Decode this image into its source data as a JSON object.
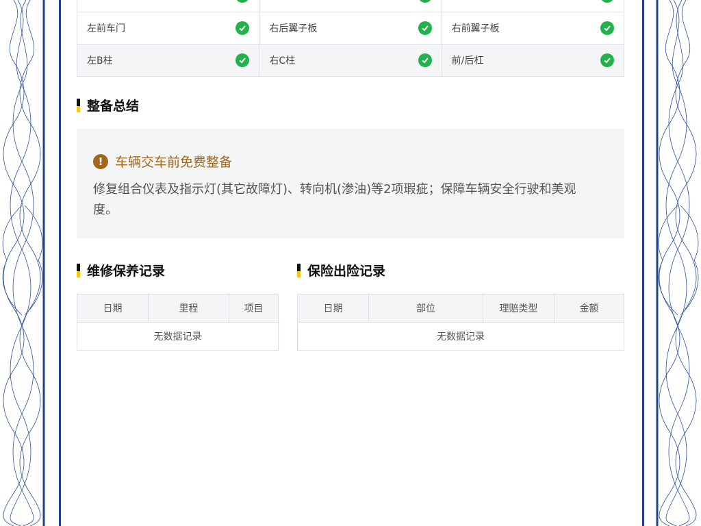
{
  "inspection_grid": {
    "rows": [
      {
        "cells": [
          {
            "label": "",
            "status_icon": "check-circle-icon"
          },
          {
            "label": "",
            "status_icon": "check-circle-icon"
          },
          {
            "label": "",
            "status_icon": "check-circle-icon"
          }
        ]
      },
      {
        "cells": [
          {
            "label": "左前车门",
            "status_icon": "check-circle-icon"
          },
          {
            "label": "右后翼子板",
            "status_icon": "check-circle-icon"
          },
          {
            "label": "右前翼子板",
            "status_icon": "check-circle-icon"
          }
        ]
      },
      {
        "cells": [
          {
            "label": "左B柱",
            "status_icon": "check-circle-icon"
          },
          {
            "label": "右C柱",
            "status_icon": "check-circle-icon"
          },
          {
            "label": "前/后杠",
            "status_icon": "check-circle-icon"
          }
        ]
      }
    ],
    "ok_color": "#22b24c"
  },
  "summary": {
    "title": "整备总结",
    "headline": "车辆交车前免费整备",
    "headline_icon": "exclamation-circle-icon",
    "headline_color": "#a3661a",
    "text": "修复组合仪表及指示灯(其它故障灯)、转向机(渗油)等2项瑕疵；保障车辆安全行驶和美观度。"
  },
  "maintenance": {
    "title": "维修保养记录",
    "columns": [
      "日期",
      "里程",
      "项目"
    ],
    "empty_text": "无数据记录"
  },
  "insurance": {
    "title": "保险出险记录",
    "columns": [
      "日期",
      "部位",
      "理赔类型",
      "金额"
    ],
    "empty_text": "无数据记录"
  },
  "colors": {
    "border_blue": "#1f3f8a",
    "accent_yellow": "#f5c518"
  }
}
